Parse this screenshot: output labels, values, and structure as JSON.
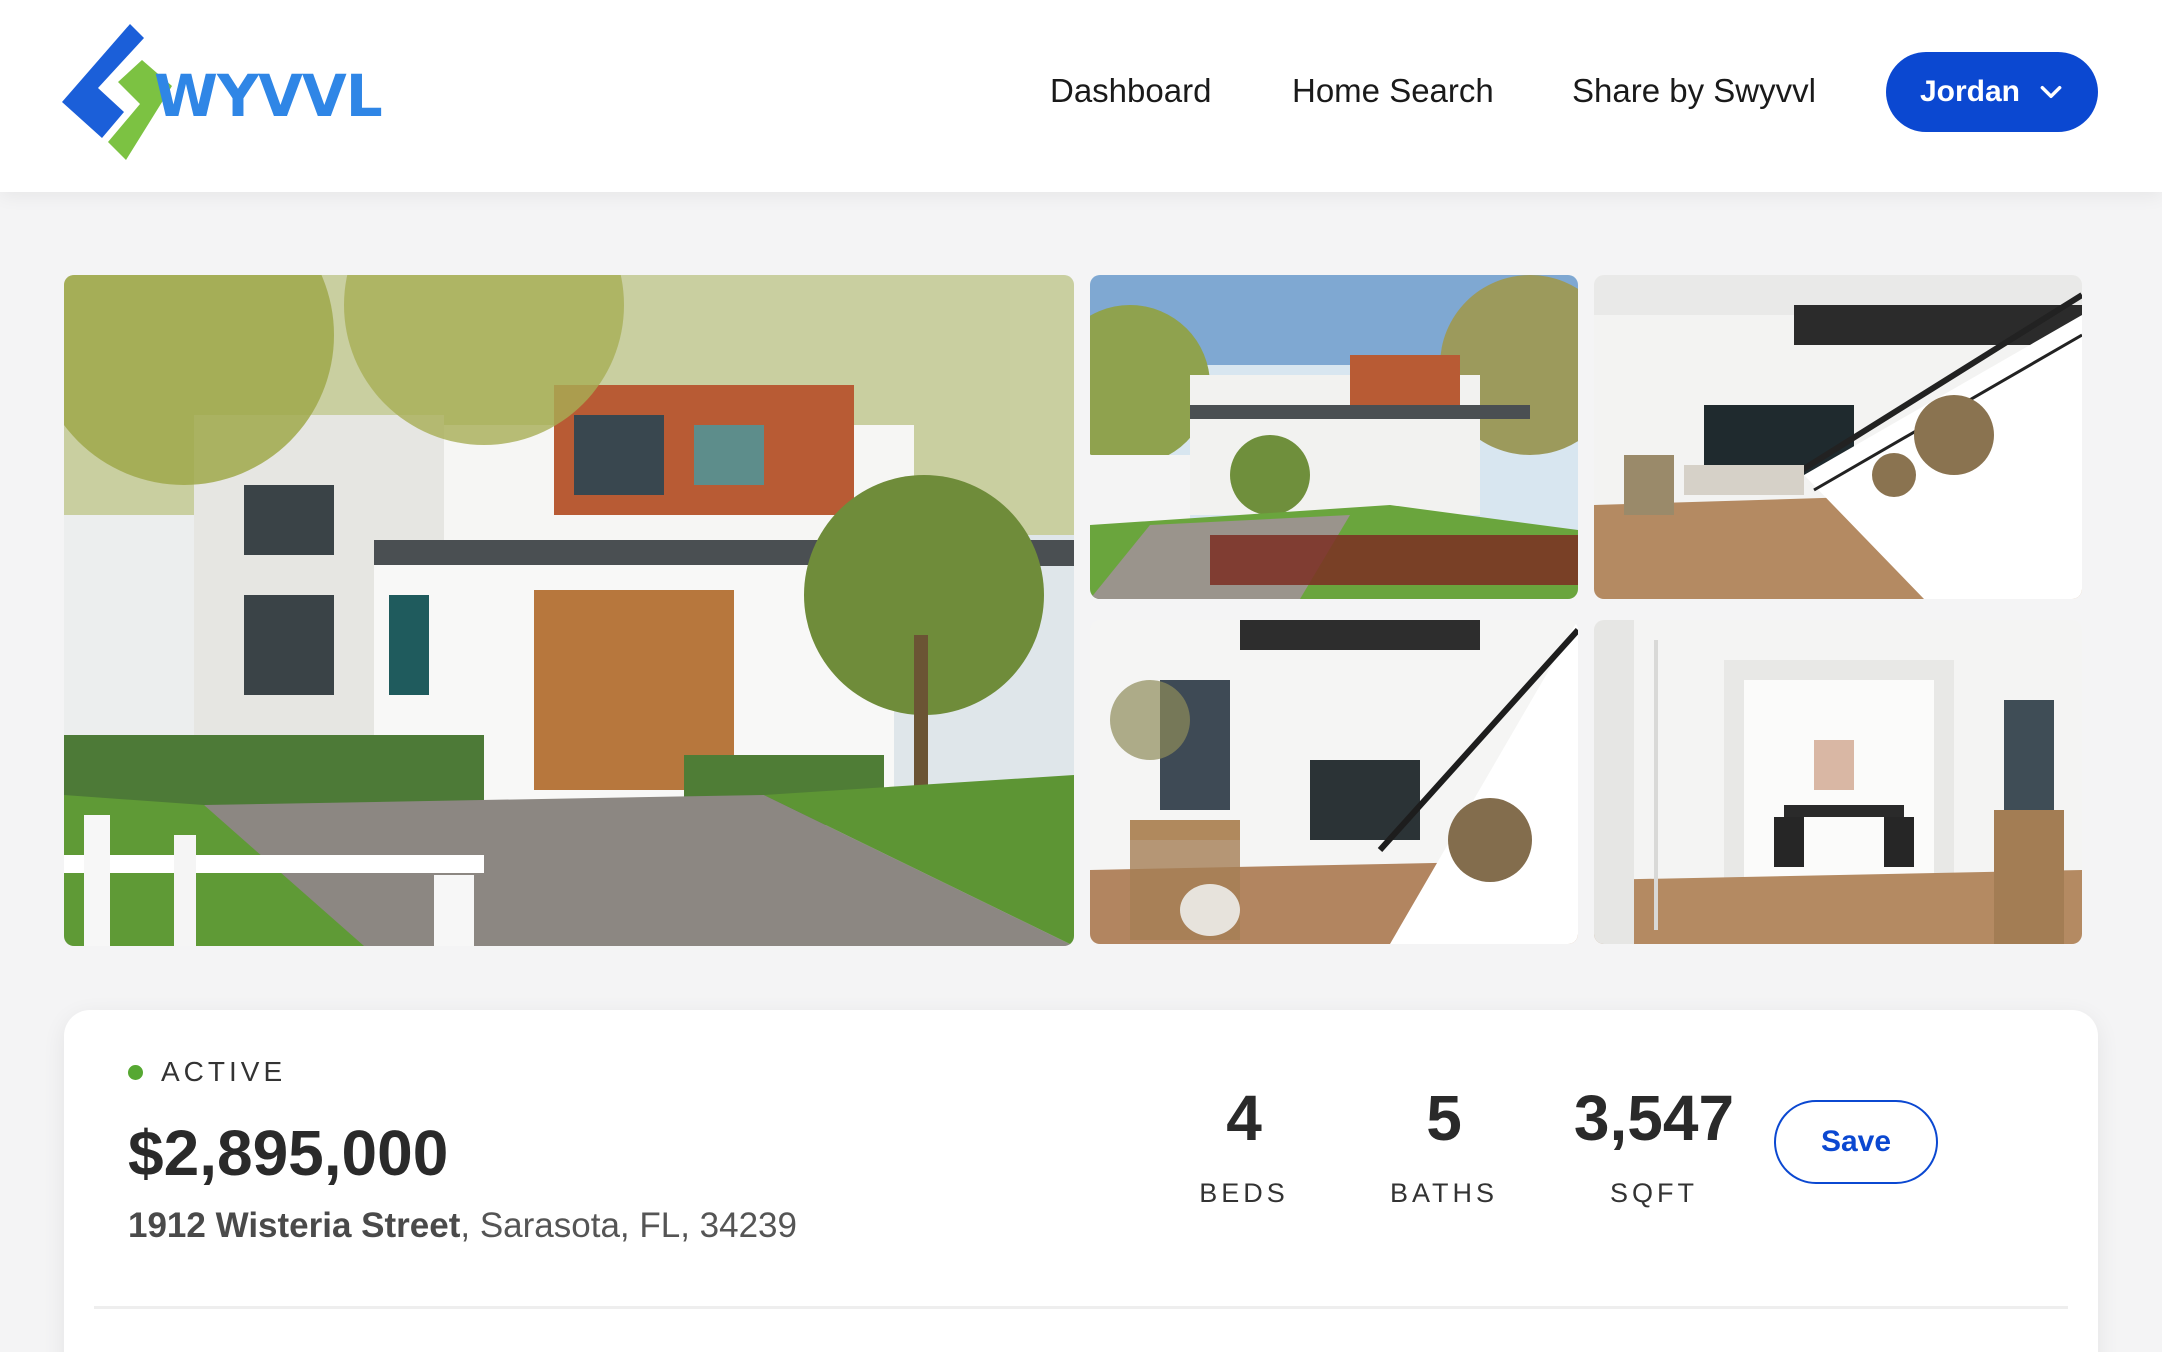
{
  "header": {
    "logo_text": "WYVVL",
    "nav": {
      "dashboard": "Dashboard",
      "home_search": "Home Search",
      "share": "Share by Swyvvl"
    },
    "user_menu": {
      "label": "Jordan"
    }
  },
  "gallery": {
    "photos": [
      "house-exterior-front",
      "house-exterior-wide",
      "staircase-living-room",
      "entry-hallway-staircase",
      "home-office-doorway"
    ]
  },
  "listing": {
    "status": "ACTIVE",
    "price": "$2,895,000",
    "street": "1912 Wisteria Street",
    "city_state_zip": ", Sarasota, FL, 34239",
    "beds_value": "4",
    "beds_label": "BEDS",
    "baths_value": "5",
    "baths_label": "BATHS",
    "sqft_value": "3,547",
    "sqft_label": "SQFT",
    "save_label": "Save"
  },
  "colors": {
    "brand_blue": "#0b48d1",
    "logo_blue": "#2f86e6",
    "logo_green": "#7cc242",
    "status_green": "#56a832"
  }
}
